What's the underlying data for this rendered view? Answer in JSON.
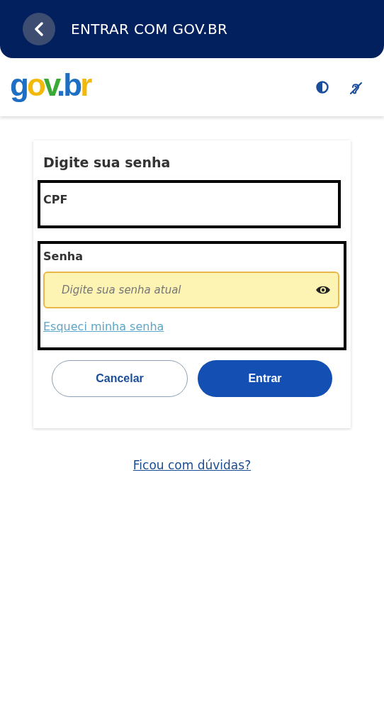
{
  "app_bar": {
    "title": "ENTRAR COM GOV.BR"
  },
  "site_header": {
    "logo": "gov.br"
  },
  "card": {
    "title": "Digite sua senha",
    "cpf_section": {
      "label": "CPF"
    },
    "password_section": {
      "label": "Senha",
      "placeholder": "Digite sua senha atual",
      "forgot_link": "Esqueci minha senha"
    },
    "buttons": [
      {
        "label": "Cancelar",
        "kind": "secondary"
      },
      {
        "label": "Entrar",
        "kind": "primary"
      }
    ]
  },
  "help_link": "Ficou com dúvidas?"
}
